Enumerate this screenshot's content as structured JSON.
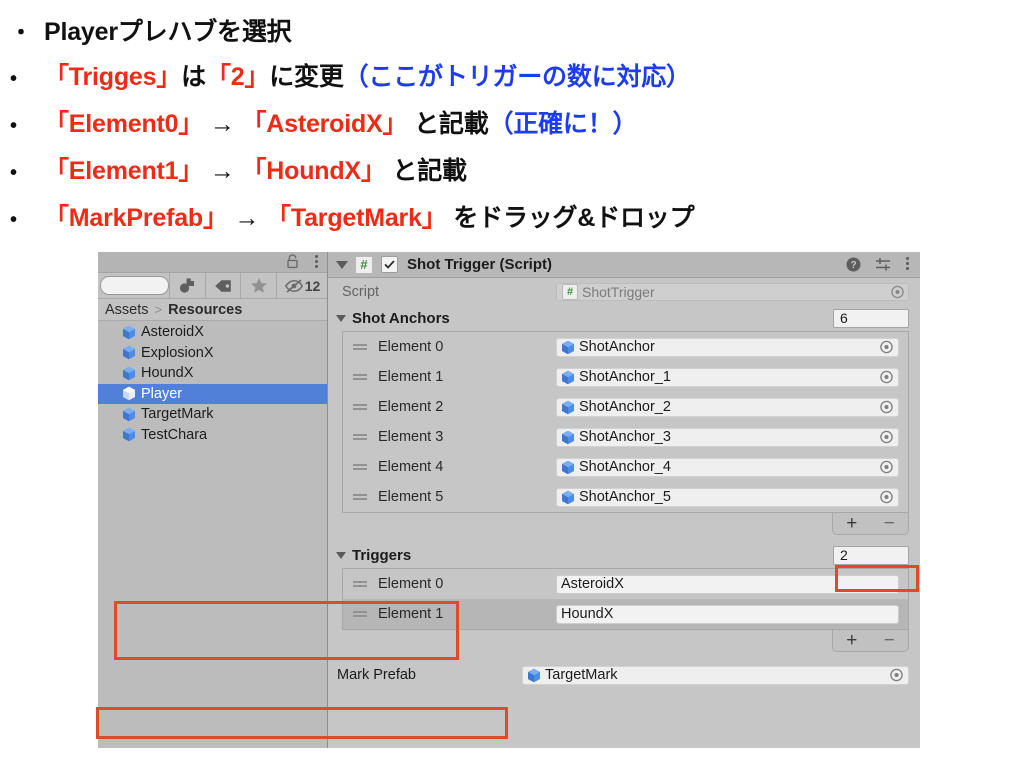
{
  "instructions": {
    "lines": [
      {
        "bullet": "・",
        "segments": [
          {
            "text": "Playerプレハブを選択",
            "color": "black"
          }
        ]
      },
      {
        "bullet": "•",
        "segments": [
          {
            "text": "「Trigges」",
            "color": "red"
          },
          {
            "text": "は",
            "color": "black"
          },
          {
            "text": "「2」",
            "color": "red"
          },
          {
            "text": "に変更",
            "color": "black"
          },
          {
            "text": "（ここがトリガーの数に対応）",
            "color": "blue"
          }
        ]
      },
      {
        "bullet": "•",
        "segments": [
          {
            "text": "「Element0」",
            "color": "red"
          },
          {
            "text": " → ",
            "color": "black"
          },
          {
            "text": "「AsteroidX」",
            "color": "red"
          },
          {
            "text": " と記載",
            "color": "black"
          },
          {
            "text": "（正確に！）",
            "color": "blue"
          }
        ]
      },
      {
        "bullet": "•",
        "segments": [
          {
            "text": "「Element1」",
            "color": "red"
          },
          {
            "text": " → ",
            "color": "black"
          },
          {
            "text": "「HoundX」",
            "color": "red"
          },
          {
            "text": " と記載",
            "color": "black"
          }
        ]
      },
      {
        "bullet": "•",
        "segments": [
          {
            "text": "「MarkPrefab」",
            "color": "red"
          },
          {
            "text": " → ",
            "color": "black"
          },
          {
            "text": "「TargetMark」",
            "color": "red"
          },
          {
            "text": " をドラッグ&ドロップ",
            "color": "black"
          }
        ]
      }
    ]
  },
  "colors": {
    "accent_red": "#ed2b17",
    "accent_blue": "#1d3cf0",
    "highlight_box": "#e2492a",
    "selection_blue": "#5080d8",
    "panel_gray": "#bcbcbc",
    "inspector_gray": "#c6c6c6"
  },
  "project_panel": {
    "title_icons": {
      "lock": "lock-icon",
      "menu": "kebab-menu-icon"
    },
    "toolbar": {
      "search_value": "",
      "search_placeholder": "",
      "buttons": [
        {
          "name": "prefab-filter-icon",
          "label": ""
        },
        {
          "name": "label-filter-icon",
          "label": ""
        },
        {
          "name": "favorites-star-icon",
          "label": ""
        },
        {
          "name": "hidden-count-icon",
          "label": "12"
        }
      ]
    },
    "breadcrumb": {
      "root": "Assets",
      "separator": ">",
      "current": "Resources"
    },
    "assets": [
      {
        "name": "AsteroidX",
        "selected": false
      },
      {
        "name": "ExplosionX",
        "selected": false
      },
      {
        "name": "HoundX",
        "selected": false
      },
      {
        "name": "Player",
        "selected": true
      },
      {
        "name": "TargetMark",
        "selected": false
      },
      {
        "name": "TestChara",
        "selected": false
      }
    ]
  },
  "inspector": {
    "component": {
      "title": "Shot Trigger (Script)",
      "badge": "#",
      "enabled": true,
      "header_icons": [
        "help-icon",
        "preset-icon",
        "kebab-menu-icon"
      ]
    },
    "script_row": {
      "label": "Script",
      "value": "ShotTrigger"
    },
    "shot_anchors": {
      "title": "Shot Anchors",
      "size": "6",
      "elements": [
        {
          "label": "Element 0",
          "value": "ShotAnchor"
        },
        {
          "label": "Element 1",
          "value": "ShotAnchor_1"
        },
        {
          "label": "Element 2",
          "value": "ShotAnchor_2"
        },
        {
          "label": "Element 3",
          "value": "ShotAnchor_3"
        },
        {
          "label": "Element 4",
          "value": "ShotAnchor_4"
        },
        {
          "label": "Element 5",
          "value": "ShotAnchor_5"
        }
      ],
      "add_label": "+",
      "remove_label": "−"
    },
    "triggers": {
      "title": "Triggers",
      "size": "2",
      "elements": [
        {
          "label": "Element 0",
          "value": "AsteroidX"
        },
        {
          "label": "Element 1",
          "value": "HoundX"
        }
      ],
      "add_label": "+",
      "remove_label": "−"
    },
    "mark_prefab": {
      "label": "Mark Prefab",
      "value": "TargetMark"
    }
  }
}
